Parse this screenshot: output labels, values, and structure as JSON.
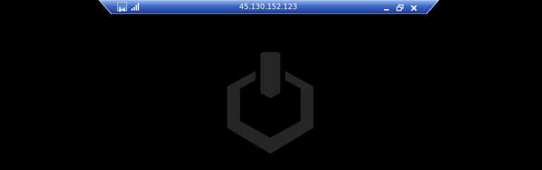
{
  "window": {
    "host": "45.130.152.123"
  },
  "connection_bar": {
    "pin_icon": "pin-icon",
    "signal_icon": "signal-strength-icon",
    "minimize_icon": "minimize-icon",
    "restore_icon": "restore-icon",
    "close_icon": "close-icon"
  },
  "colors": {
    "bar_top": "#7aa1e6",
    "bar_bottom": "#1d3f98",
    "desktop_bg": "#000000",
    "logo": "#262626"
  },
  "desktop": {
    "logo_icon": "hexagon-power-logo-icon"
  }
}
